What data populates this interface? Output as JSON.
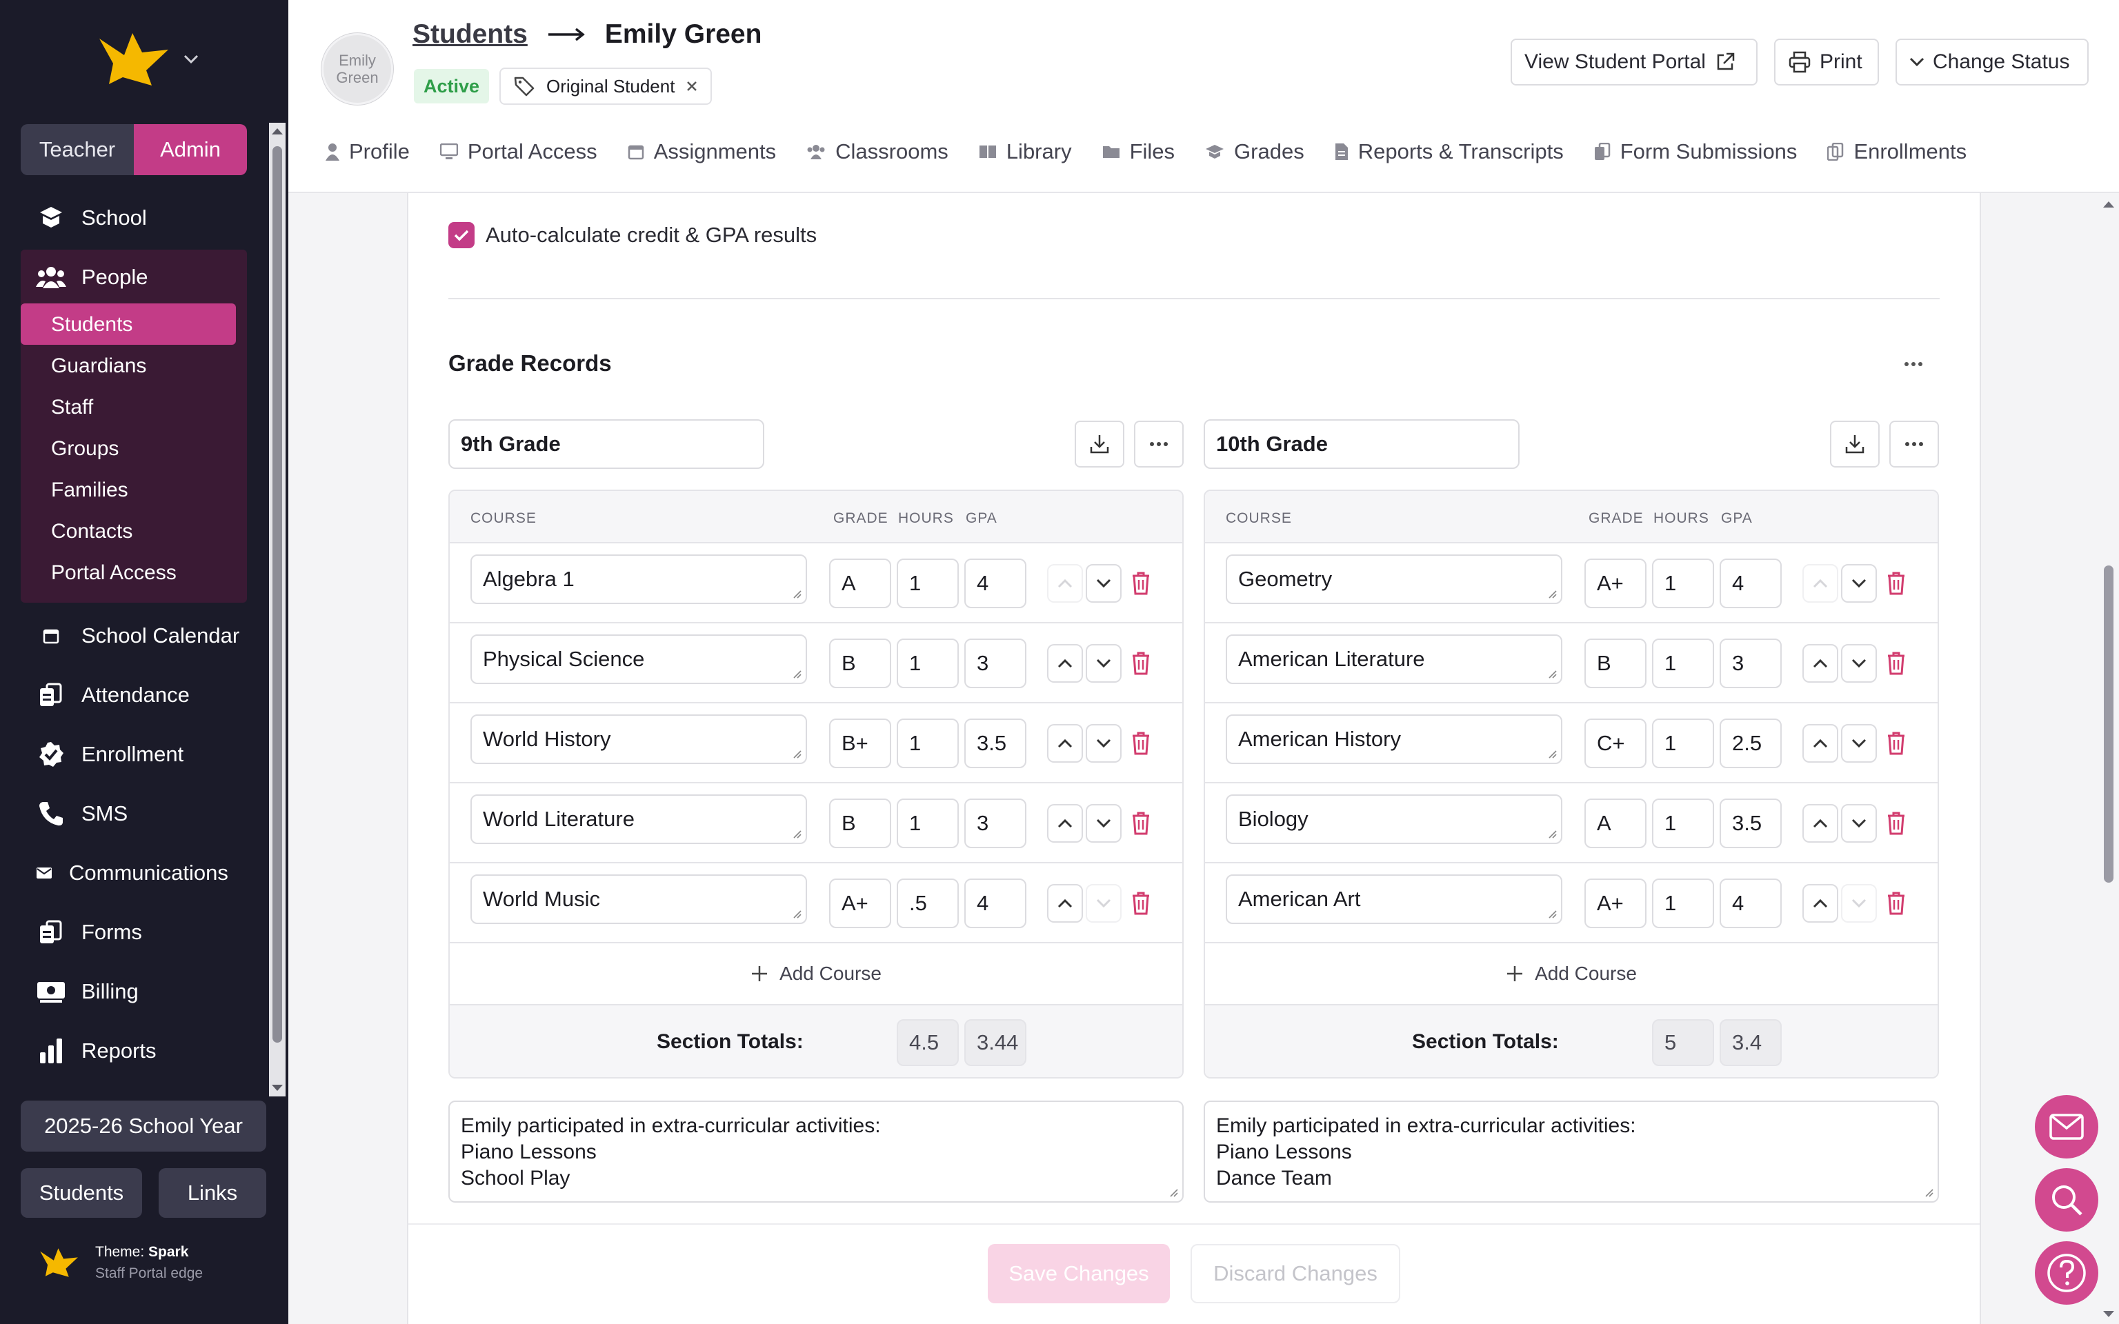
{
  "sidebar": {
    "role_toggle": [
      "Teacher",
      "Admin"
    ],
    "items": [
      {
        "label": "School",
        "icon": "school-icon"
      },
      {
        "label": "People",
        "icon": "people-icon"
      },
      {
        "label": "School Calendar",
        "icon": "calendar-icon"
      },
      {
        "label": "Attendance",
        "icon": "attendance-icon"
      },
      {
        "label": "Enrollment",
        "icon": "check-badge-icon"
      },
      {
        "label": "SMS",
        "icon": "phone-icon"
      },
      {
        "label": "Communications",
        "icon": "mail-icon"
      },
      {
        "label": "Forms",
        "icon": "forms-icon"
      },
      {
        "label": "Billing",
        "icon": "billing-icon"
      },
      {
        "label": "Reports",
        "icon": "reports-icon"
      }
    ],
    "people_sub": [
      "Students",
      "Guardians",
      "Staff",
      "Groups",
      "Families",
      "Contacts",
      "Portal Access"
    ],
    "school_year": "2025-26 School Year",
    "bottom_buttons": [
      "Students",
      "Links"
    ],
    "theme_label": "Theme: ",
    "theme_name": "Spark",
    "theme_sub": "Staff Portal edge"
  },
  "header": {
    "avatar_text": "Emily Green",
    "crumb_parent": "Students",
    "crumb_current": "Emily Green",
    "status": "Active",
    "tag": "Original Student",
    "btn_portal": "View Student Portal",
    "btn_print": "Print",
    "btn_status": "Change Status",
    "tabs": [
      "Profile",
      "Portal Access",
      "Assignments",
      "Classrooms",
      "Library",
      "Files",
      "Grades",
      "Reports & Transcripts",
      "Form Submissions",
      "Enrollments"
    ]
  },
  "main": {
    "auto_calc_label": "Auto-calculate credit & GPA results",
    "grade_records_title": "Grade Records",
    "col_course": "COURSE",
    "col_grade": "GRADE",
    "col_hours": "HOURS",
    "col_gpa": "GPA",
    "add_course": "Add Course",
    "totals_label": "Section Totals:",
    "save": "Save Changes",
    "discard": "Discard Changes",
    "sections": [
      {
        "name": "9th Grade",
        "rows": [
          {
            "course": "Algebra 1",
            "grade": "A",
            "hours": "1",
            "gpa": "4"
          },
          {
            "course": "Physical Science",
            "grade": "B",
            "hours": "1",
            "gpa": "3"
          },
          {
            "course": "World History",
            "grade": "B+",
            "hours": "1",
            "gpa": "3.5"
          },
          {
            "course": "World Literature",
            "grade": "B",
            "hours": "1",
            "gpa": "3"
          },
          {
            "course": "World Music",
            "grade": "A+",
            "hours": ".5",
            "gpa": "4"
          }
        ],
        "total_hours": "4.5",
        "total_gpa": "3.44",
        "notes": "Emily participated in extra-curricular activities:\nPiano Lessons\nSchool Play"
      },
      {
        "name": "10th Grade",
        "rows": [
          {
            "course": "Geometry",
            "grade": "A+",
            "hours": "1",
            "gpa": "4"
          },
          {
            "course": "American Literature",
            "grade": "B",
            "hours": "1",
            "gpa": "3"
          },
          {
            "course": "American History",
            "grade": "C+",
            "hours": "1",
            "gpa": "2.5"
          },
          {
            "course": "Biology",
            "grade": "A",
            "hours": "1",
            "gpa": "3.5"
          },
          {
            "course": "American Art",
            "grade": "A+",
            "hours": "1",
            "gpa": "4"
          }
        ],
        "total_hours": "5",
        "total_gpa": "3.4",
        "notes": "Emily participated in extra-curricular activities:\nPiano Lessons\nDance Team"
      }
    ]
  },
  "colors": {
    "accent": "#c33c87",
    "sidebar_bg": "#1b1b29",
    "active_green": "#2f9e49",
    "trash": "#d23c6e"
  }
}
